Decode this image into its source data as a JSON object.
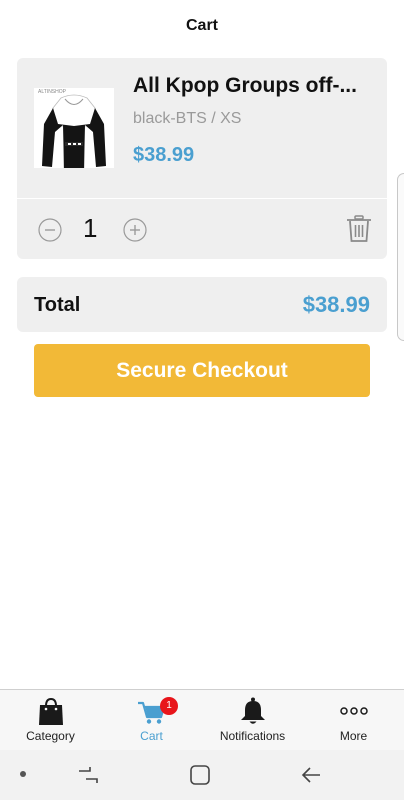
{
  "header": {
    "title": "Cart"
  },
  "cart_item": {
    "name": "All Kpop Groups off-...",
    "variant": "black-BTS / XS",
    "price": "$38.99",
    "quantity": "1",
    "thumbnail_brand": "ALTINSHOP"
  },
  "summary": {
    "total_label": "Total",
    "total_value": "$38.99"
  },
  "checkout": {
    "label": "Secure Checkout"
  },
  "tabs": [
    {
      "label": "Category",
      "icon": "shopping-bag-icon"
    },
    {
      "label": "Cart",
      "icon": "cart-icon",
      "badge": "1"
    },
    {
      "label": "Notifications",
      "icon": "bell-icon"
    },
    {
      "label": "More",
      "icon": "more-dots-icon"
    }
  ],
  "colors": {
    "accent_blue": "#4a9fd0",
    "checkout_yellow": "#f2b937",
    "badge_red": "#e8151b",
    "card_bg": "#efefef"
  }
}
